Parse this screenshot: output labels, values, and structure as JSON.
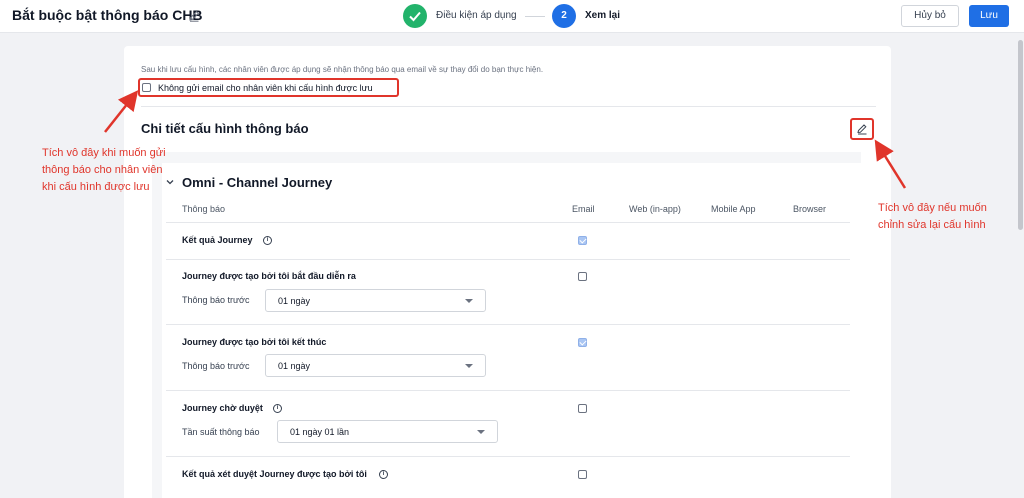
{
  "header": {
    "title": "Bắt buộc bật thông báo CHB",
    "steps": [
      {
        "label": "Điều kiện áp dụng",
        "state": "done"
      },
      {
        "label": "Xem lại",
        "number": "2",
        "state": "active"
      }
    ],
    "cancel_label": "Hủy bỏ",
    "save_label": "Lưu"
  },
  "review": {
    "description": "Sau khi lưu cấu hình, các nhân viên được áp dụng sẽ nhận thông báo qua email về sự thay đổi do bạn thực hiện.",
    "no_email_label": "Không gửi email cho nhân viên khi cấu hình được lưu",
    "no_email_checked": false,
    "section_title": "Chi tiết cấu hình thông báo"
  },
  "journey": {
    "title": "Omni - Channel Journey",
    "columns": [
      "Thông báo",
      "Email",
      "Web (in-app)",
      "Mobile App",
      "Browser"
    ],
    "rows": [
      {
        "label": "Kết quả Journey",
        "info": true,
        "email_checked": true
      },
      {
        "label": "Journey được tạo bởi tôi bắt đầu diễn ra",
        "email_checked": false,
        "sub_label": "Thông báo trước",
        "dropdown": "01 ngày"
      },
      {
        "label": "Journey được tạo bởi tôi kết thúc",
        "email_checked": true,
        "sub_label": "Thông báo trước",
        "dropdown": "01 ngày"
      },
      {
        "label": "Journey chờ duyệt",
        "info": true,
        "email_checked": false,
        "sub_label": "Tần suất thông báo",
        "dropdown": "01 ngày 01 lần"
      },
      {
        "label": "Kết quả xét duyệt Journey được tạo bởi tôi",
        "info": true,
        "email_checked": false
      }
    ]
  },
  "annotations": {
    "left": [
      "Tích vô đây khi muốn gửi",
      "thông báo cho nhân viên",
      "khi cấu hình được lưu"
    ],
    "right": [
      "Tích vô đây nếu muốn",
      "chỉnh sửa lại cấu hình"
    ]
  },
  "colors": {
    "primary": "#1f6fe5",
    "success": "#22b36b",
    "annotation": "#e0352b"
  },
  "icons": {
    "title_edit": "pencil-icon",
    "step_done": "check-icon",
    "config_edit": "pencil-icon",
    "collapse": "chevron-down-icon",
    "info": "info-icon",
    "dropdown": "caret-down-icon"
  }
}
